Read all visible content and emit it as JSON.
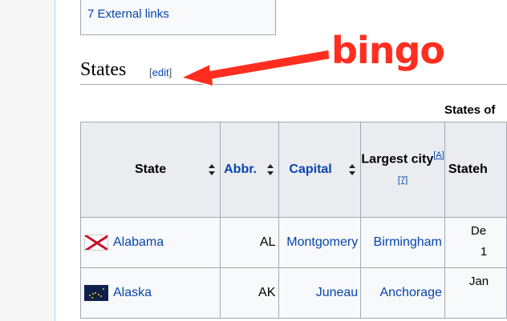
{
  "toc": {
    "item": "7 External links"
  },
  "section": {
    "title": "States",
    "edit_open": "[",
    "edit_label": "edit",
    "edit_close": "]"
  },
  "table": {
    "caption": "States of",
    "headers": {
      "state": "State",
      "abbr": "Abbr.",
      "capital": "Capital",
      "largest_city": "Largest city",
      "largest_city_refs": [
        "[A]",
        "[7]"
      ],
      "statehood": "Stateh"
    },
    "rows": [
      {
        "state": "Alabama",
        "abbr": "AL",
        "capital": "Montgomery",
        "largest_city": "Birmingham",
        "statehood_top": "De",
        "statehood_bottom": "1"
      },
      {
        "state": "Alaska",
        "abbr": "AK",
        "capital": "Juneau",
        "largest_city": "Anchorage",
        "statehood_top": "Jan",
        "statehood_bottom": ""
      }
    ]
  },
  "annotation": {
    "text": "bingo",
    "color": "#ff2e1f"
  },
  "colors": {
    "link": "#0645ad",
    "border": "#a2a9b1",
    "header_bg": "#eaecf0"
  }
}
